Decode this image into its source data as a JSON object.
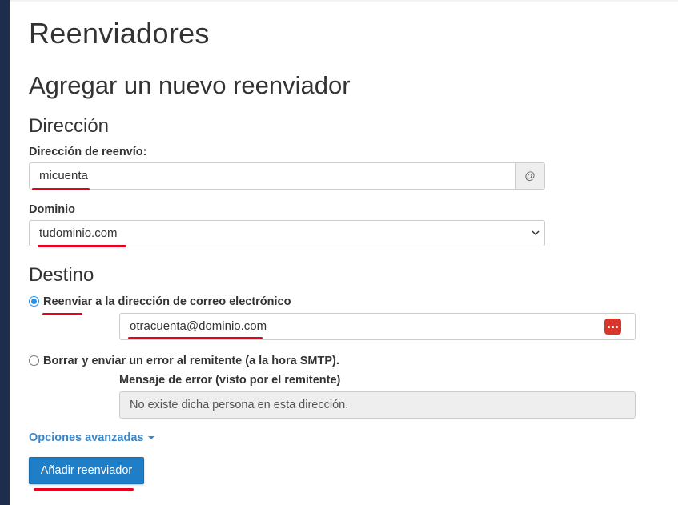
{
  "page": {
    "title": "Reenviadores"
  },
  "form": {
    "title": "Agregar un nuevo reenviador",
    "address": {
      "section_title": "Dirección",
      "forward_label": "Dirección de reenvío:",
      "forward_value": "micuenta",
      "at_symbol": "@",
      "domain_label": "Dominio",
      "domain_value": "tudominio.com"
    },
    "destination": {
      "section_title": "Destino",
      "option_forward_label": "Reenviar a la dirección de correo electrónico",
      "option_forward_selected": true,
      "forward_email_value": "otracuenta@dominio.com",
      "option_fail_label": "Borrar y enviar un error al remitente (a la hora SMTP).",
      "error_message_label": "Mensaje de error (visto por el remitente)",
      "error_message_placeholder": "No existe dicha persona en esta dirección."
    },
    "advanced_options_label": "Opciones avanzadas",
    "submit_label": "Añadir reenviador"
  },
  "colors": {
    "sidebar": "#1f2d4d",
    "primary_button": "#1e7ec8",
    "link": "#3b86c8",
    "radio_checked": "#2f8fe0",
    "password_manager_icon": "#d9352b",
    "annotation_underline": "#e8001c"
  },
  "icons": {
    "domain_select": "chevron-down-icon",
    "email_field_extension": "password-manager-icon",
    "advanced_options": "caret-down-icon"
  }
}
